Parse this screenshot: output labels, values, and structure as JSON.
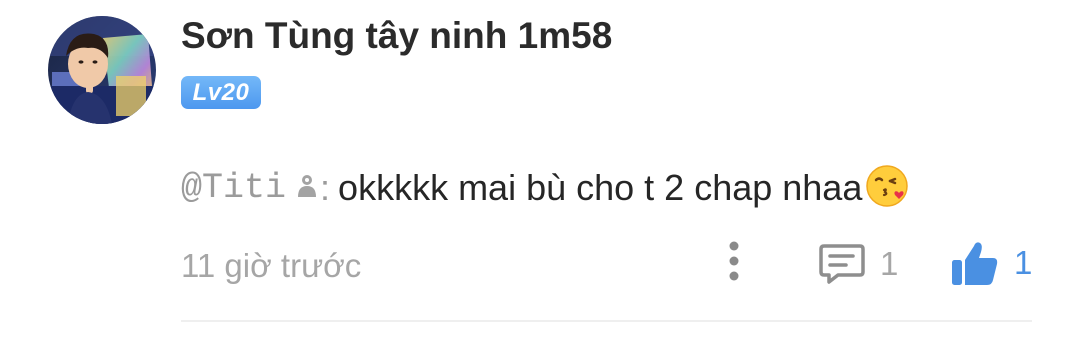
{
  "comment": {
    "author": {
      "name": "Sơn Tùng tây ninh 1m58",
      "level": "Lv20",
      "avatar_icon": "user-avatar-photo"
    },
    "mention": {
      "username": "@Titi",
      "icon": "user-silhouette-icon",
      "separator": ":"
    },
    "text": "okkkkk mai bù cho t 2 chap nhaa",
    "emoji": "face-blowing-kiss-emoji",
    "timestamp": "11 giờ trước",
    "actions": {
      "more_icon": "vertical-dots-icon",
      "reply_icon": "comment-bubble-icon",
      "reply_count": "1",
      "like_icon": "thumbs-up-icon",
      "like_count": "1"
    }
  },
  "colors": {
    "badge": "#5aa5f3",
    "like_accent": "#4a90e2",
    "muted_text": "#a6a6a6",
    "primary_text": "#262626"
  }
}
